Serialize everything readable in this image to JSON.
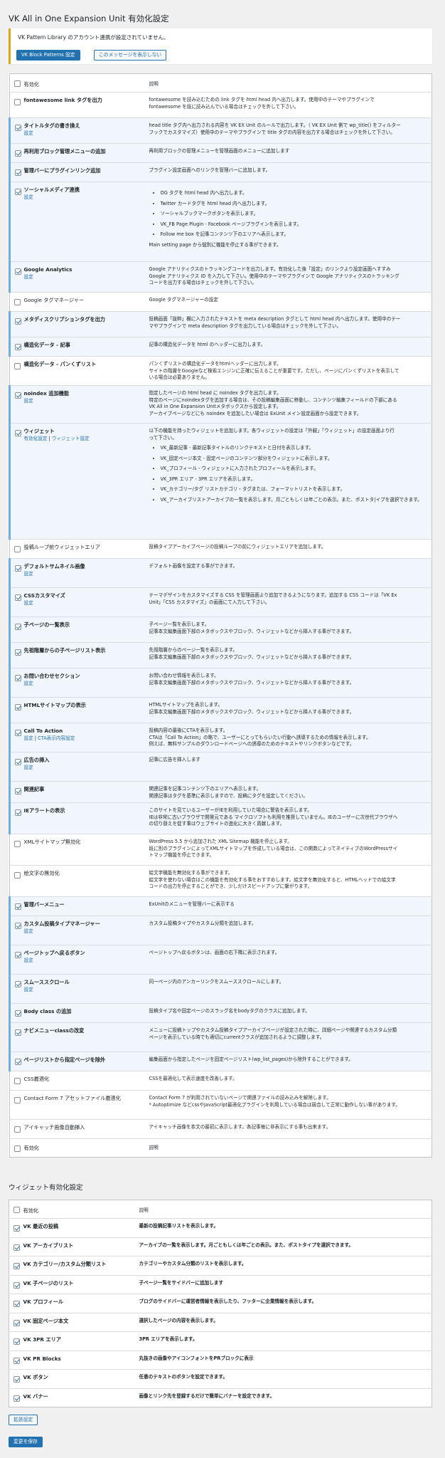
{
  "page_title": "VK All in One Expansion Unit 有効化設定",
  "notice": {
    "message": "VK Pattern Library のアカウント連携が設定されていません。",
    "primary_button": "VK Block Patterns 設定",
    "secondary_button": "このメッセージを表示しない"
  },
  "colors": {
    "accent": "#2271b1",
    "active_border": "#72aee6",
    "notice_border": "#dba617"
  },
  "main_table": {
    "header": {
      "name": "有効化",
      "description": "説明"
    },
    "footer": {
      "name": "有効化",
      "description": "説明"
    },
    "rows": [
      {
        "name": "fontawesome link タグを出力",
        "checked": false,
        "desc": [
          "fontawesome を読み込むための link タグを html head 内へ出力します。使用中のテーマやプラグインで",
          "fontawesome を既に読み込んでいる場合はチェックを外して下さい。"
        ]
      },
      {
        "name": "タイトルタグの書き換え",
        "checked": true,
        "links": [
          "設定"
        ],
        "desc": [
          "head title タグ内へ出力される内容を VK EX Unit のルールで出力します。（ VK EX Unit 側で wp_title() をフィルター",
          "フックでカスタマイズ）使用中のテーマやプラグインで title タグの内容を出力する場合はチェックを外して下さい。"
        ]
      },
      {
        "name": "再利用ブロック管理メニューの追加",
        "checked": true,
        "desc": [
          "再利用ブロックの管理メニューを管理画面のメニューに追加します"
        ]
      },
      {
        "name": "管理バーにプラグインリンク追加",
        "checked": true,
        "desc": [
          "プラグイン設定画面へのリンクを管理バーに追加します。"
        ]
      },
      {
        "name": "ソーシャルメディア連携",
        "checked": true,
        "links": [
          "設定"
        ],
        "desc": [],
        "list": [
          "OG タグを html head 内へ出力します。",
          "Twitter カードタグを html head 内へ出力します。",
          "ソーシャルブックマークボタンを表示します。",
          "VK_FB Page Plugin - Facebook ページプラグインを表示します。",
          "Follow me box を記事コンテンツ下のエリアへ表示します。"
        ],
        "after": {
          "link": "Main setting page",
          "text": " から個別に機能を停止する事ができます。"
        }
      },
      {
        "name": "Google Analytics",
        "checked": true,
        "links": [
          "設定"
        ],
        "desc": [
          "Google アナリティクスのトラッキングコードを出力します。有効化した後「設定」のリンクより設定画面へすすみ",
          "Google アナリティクス ID を入力して下さい。使用中のテーマやプラグインで Google アナリティクスのトラッキング",
          "コードを出力する場合はチェックを外して下さい。"
        ]
      },
      {
        "name": "Google タグマネージャー",
        "checked": false,
        "plain": true,
        "desc": [
          "Google タグマネージャーの設定"
        ]
      },
      {
        "name": "メタディスクリプションタグを出力",
        "checked": true,
        "desc": [
          "投稿画面「抜粋」欄に入力されたテキストを meta description タグとして html head 内へ出力します。使用中のテー",
          "マやプラグインで meta description タグを出力している場合はチェックを外して下さい。"
        ]
      },
      {
        "name": "構造化データ - 記事",
        "checked": true,
        "desc": [
          "記事の構造化データを html のヘッダーに出力します。"
        ]
      },
      {
        "name": "構造化データ - パンくずリスト",
        "checked": false,
        "desc": [
          "パンくずリストの構造化データをhtmlヘッダーに出力します。",
          "サイトの階層をGoogleなど検索エンジンに正確に伝えることが重要です。ただし、ページにパンくずリストを表示して",
          "いる場合は必要ありません。"
        ]
      },
      {
        "name": "noindex 追加機能",
        "checked": true,
        "links": [
          "設定"
        ],
        "desc": [
          "指定したページの html head に noindex タグを出力します。",
          "特定のページにnoindexタグを追加する場合は、その投稿編集画面に移動し、コンテンツ編集フィールドの下部にある",
          "VK All in One Expansion Unitメタボックスから設定します。",
          "アーカイブページなどにも noindex を追加したい場合は ExUnit メイン設定画面から設定できます。"
        ]
      },
      {
        "name": "ウィジェット",
        "checked": true,
        "links": [
          "有効化設定",
          "ウィジェット設定"
        ],
        "desc": [
          "以下の機能を持ったウィジェットを追加します。各ウィジェットの設定は「外観」「ウィジェット」の設定画面より行",
          "って下さい。"
        ],
        "list": [
          "VK_最新記事 - 最新記事タイトルのリンクテキストと日付を表示します。",
          "VK_固定ページ本文 - 固定ページのコンテンツ部分をウィジェットに表示します。",
          "VK_プロフィール - ウィジェットに入力されたプロフィールを表示します。",
          "VK_3PR エリア - 3PR エリアを表示します。",
          "VK_カテゴリー/タグ リストカテゴリ・タグまたは、フォーマットリストを表示します。",
          "VK_アーカイブリストアーカイブの一覧を表示します。月ごともしくは年ごとの表示。また、ポストタ|イプを選択できます。"
        ]
      },
      {
        "name": "投稿ループ前ウィジェットエリア",
        "checked": false,
        "plain": true,
        "desc": [
          "投稿タイプアーカイブページの投稿ループの前にウィジェットエリアを追加します。"
        ]
      },
      {
        "name": "デフォルトサムネイル画像",
        "checked": true,
        "links": [
          "設定"
        ],
        "desc": [
          "デフォルト画像を設定する事ができます。"
        ]
      },
      {
        "name": "CSSカスタマイズ",
        "checked": true,
        "links": [
          "設定"
        ],
        "desc": [
          "テーマデザインをカスタマイズする CSS を管理画面より追加できるようになります。追加する CSS コードは「VK Ex",
          "Unit」「CSS カスタマイズ」の画面にて入力して下さい。"
        ]
      },
      {
        "name": "子ページの一覧表示",
        "checked": true,
        "desc": [
          "子ページ一覧を表示します。",
          "記事本文編集画面下部のメタボックスやブロック、ウィジェットなどから挿入する事ができます。"
        ]
      },
      {
        "name": "先祖階層からの子ページリスト表示",
        "checked": true,
        "desc": [
          "先祖階層からのページ一覧を表示します。",
          "記事本文編集画面下部のメタボックスやブロック、ウィジェットなどから挿入する事ができます。"
        ]
      },
      {
        "name": "お問い合わせセクション",
        "checked": true,
        "links": [
          "設定"
        ],
        "desc": [
          "お問い合わせ情報を表示します。",
          "記事本文編集画面下部のメタボックスやブロック、ウィジェットなどから挿入する事ができます。"
        ]
      },
      {
        "name": "HTMLサイトマップの表示",
        "checked": true,
        "desc": [
          "HTMLサイトマップを表示します。",
          "記事本文編集画面下部のメタボックスやブロック、ウィジェットなどから挿入する事ができます。"
        ]
      },
      {
        "name": "Call To Action",
        "checked": true,
        "links": [
          "設定",
          "CTA表示内容設定"
        ],
        "desc": [
          "投稿内容の最後にCTAを表示します。",
          "CTAは「Call To Action」の略で、ユーザーにとってもらいたい行動へ誘導するための情報を表示します。",
          "例えば、無料サンプルのダウンロードページへの誘導のためのテキストやリンクボタンなどです。"
        ]
      },
      {
        "name": "広告の挿入",
        "checked": true,
        "links": [
          "設定"
        ],
        "desc": [
          "記事に広告を挿入します"
        ]
      },
      {
        "name": "関連記事",
        "checked": true,
        "desc": [
          "関連記事を記事コンテンツ下のエリアへ表示します。",
          "関連記事はタグを基準に表示しますので、投稿にタグを設定してください。"
        ]
      },
      {
        "name": "IEアラートの表示",
        "checked": true,
        "desc": [
          "このサイトを見ているユーザーがIEを利用していた場合に警告を表示します。",
          "IEは非常に古いブラウザで開発元である マイクロソフトも利用を推奨していません。IEのユーザーに次世代ブラウザへ",
          "の切り替えを促す事はウェブサイトの進化に大きく貢献します。"
        ]
      },
      {
        "name": "XMLサイトマップ無効化",
        "checked": false,
        "plain": true,
        "desc": [
          "WordPress 5.5 から追加された XML Sitemap 機能を停止します。",
          "既に別のプラグインによってXMLサイトマップを作成している場合は、この関数によってネイティブのWordPressサイ",
          "トマップ機能を停止できます。"
        ]
      },
      {
        "name": "絵文字の無効化",
        "checked": false,
        "plain": true,
        "desc": [
          "絵文字機能を無効化する事ができます。",
          "絵文字を使わない場合はこの機能を有効化する事をおすすめします。絵文字を無効化すると、HTMLヘッドでの絵文字",
          "コードの出力を停止することができ、少しだけスピードアップに繋がります。"
        ]
      },
      {
        "name": "管理バーメニュー",
        "checked": true,
        "desc": [
          "ExUnitのメニューを管理バーに表示する"
        ]
      },
      {
        "name": "カスタム投稿タイプマネージャー",
        "checked": true,
        "links": [
          "設定"
        ],
        "desc": [
          "カスタム投稿タイプやカスタム分類を追加します。"
        ]
      },
      {
        "name": "ページトップへ戻るボタン",
        "checked": true,
        "links": [
          "設定"
        ],
        "desc": [
          "ページトップへ戻るボタンは、画面の右下隅に表示されます。"
        ]
      },
      {
        "name": "スムーススクロール",
        "checked": true,
        "links": [
          "設定"
        ],
        "desc": [
          "同一ページ内のアンカーリンクをスムーススクロールにします。"
        ]
      },
      {
        "name": "Body class の追加",
        "checked": true,
        "desc": [
          "投稿タイプ名や固定ページのスラッグ名をbodyタグのクラスに追加します。"
        ]
      },
      {
        "name": "ナビメニューclassの改変",
        "checked": true,
        "desc": [
          "メニューに投稿トップやカスタム投稿タイプアーカイブページが設定された時に、詳細ページや関連するカスタム分類",
          "ページを表示している時でも適切にcurrentクラスが追加されるように調整します。"
        ]
      },
      {
        "name": "ページリストから指定ページを除外",
        "checked": true,
        "desc": [
          "編集画面から指定したページを固定ページリスト(wp_list_pages)から除外することができます。"
        ]
      },
      {
        "name": "CSS最適化",
        "checked": false,
        "plain": true,
        "desc": [
          "CSSを最適化して表示速度を改善します。"
        ]
      },
      {
        "name": "Contact Form 7 アセットファイル最適化",
        "checked": false,
        "plain": true,
        "desc": [
          "Contact Form 7 が利用されていないページで関連ファイルの読み込みを解除します。",
          "* Autoptimize などcssやJavaScript最適化プラグインを利用している場合は競合して正常に動作しない事があります。"
        ]
      },
      {
        "name": "アイキャッチ画像自動挿入",
        "checked": false,
        "plain": true,
        "desc": [
          "アイキャッチ画像を本文の最初に表示します。各記事毎に非表示にする事も出来ます。"
        ]
      }
    ]
  },
  "widget_section": {
    "title": "ウィジェット有効化設定",
    "header": {
      "name": "有効化",
      "description": "説明"
    },
    "rows": [
      {
        "name": "VK 最近の投稿",
        "desc": "最新の投稿記事リストを表示します。"
      },
      {
        "name": "VK アーカイブリスト",
        "desc": "アーカイブの一覧を表示します。月ごともしくは年ごとの表示。また、ポストタイプを選択できます。"
      },
      {
        "name": "VK カテゴリー/カスタム分類リスト",
        "desc": "カテゴリーやカスタム分類のリストを表示します。"
      },
      {
        "name": "VK 子ページのリスト",
        "desc": "子ページ一覧をサイドバーに追加します"
      },
      {
        "name": "VK プロフィール",
        "desc": "ブログのサイドバーに運営者情報を表示したり、フッターに企業情報を表示します。"
      },
      {
        "name": "VK 固定ページ本文",
        "desc": "選択したページの内容を表示します。"
      },
      {
        "name": "VK 3PR エリア",
        "desc": "3PR エリアを表示します。"
      },
      {
        "name": "VK PR Blocks",
        "desc": "丸抜きの画像やアイコンフォントをPRブロックに表示"
      },
      {
        "name": "VK ボタン",
        "desc": "任意のテキストのボタンを設定できます。"
      },
      {
        "name": "VK バナー",
        "desc": "画像とリンク先を登録するだけで簡単にバナーを設定できます。"
      }
    ]
  },
  "buttons": {
    "extension": "拡張設定",
    "save": "変更を保存"
  }
}
